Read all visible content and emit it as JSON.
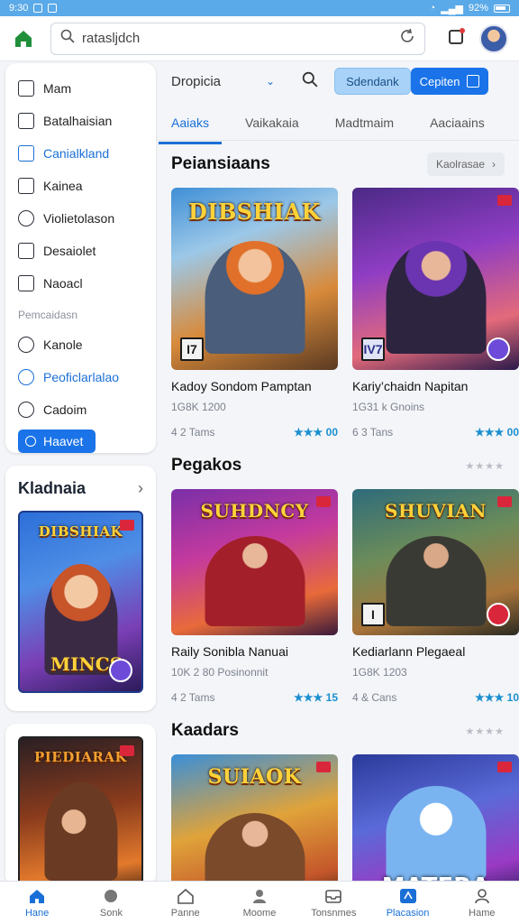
{
  "status": {
    "time": "9:30",
    "battery": "92%"
  },
  "topbar": {
    "search_value": "ratasljdch"
  },
  "sidebar": {
    "items": [
      {
        "label": "Mam",
        "blue": false
      },
      {
        "label": "Batalhaisian",
        "blue": false
      },
      {
        "label": "Canialkland",
        "blue": true
      },
      {
        "label": "Kainea",
        "blue": false
      },
      {
        "label": "Violietolason",
        "blue": false
      },
      {
        "label": "Desaiolet",
        "blue": false
      },
      {
        "label": "Naoacl",
        "blue": false
      }
    ],
    "section_label": "Pemcaidasn",
    "items2": [
      {
        "label": "Kanole",
        "blue": false
      },
      {
        "label": "Peoficlarlalao",
        "blue": true
      },
      {
        "label": "Cadoim",
        "blue": false
      }
    ],
    "active_label": "Haavet"
  },
  "side_card": {
    "title": "Kladnaia",
    "art1_title": "DIBSHIAK",
    "art1_footer": "MINCS",
    "art2_title": "PIEDIARAK"
  },
  "main": {
    "dropdown": "Dropicia",
    "btn_light": "Sdendank",
    "btn_primary": "Cepiten",
    "tabs": [
      "Aaiaks",
      "Vaikakaia",
      "Madtmaim",
      "Aaciaains"
    ],
    "sections": [
      {
        "title": "Peiansiaans",
        "more": "Kaolrasae",
        "cards": [
          {
            "art_title": "DIBSHIAK",
            "tag": "I7",
            "name": "Kadoy Sondom Pamptan",
            "meta": "1G8K 1200",
            "players": "4 2 Tams",
            "rating": "★★★ 00"
          },
          {
            "art_title": "",
            "tag": "IV7",
            "name": "Kariy’chaidn Napitan",
            "meta": "1G31 k Gnoins",
            "players": "6 3 Tans",
            "rating": "★★★ 00"
          }
        ]
      },
      {
        "title": "Pegakos",
        "more_stars": "★★★★",
        "cards": [
          {
            "art_title": "SUHDNCY",
            "tag": "",
            "name": "Raily Sonibla Nanuai",
            "meta": "10K 2 80 Posinonnit",
            "players": "4 2 Tams",
            "rating": "★★★ 15"
          },
          {
            "art_title": "SHUVIAN",
            "tag": "I",
            "name": "Kediarlann Plegaeal",
            "meta": "1G8K 1203",
            "players": "4 & Cans",
            "rating": "★★★ 10"
          }
        ]
      },
      {
        "title": "Kaadars",
        "more_stars": "★★★★",
        "cards": [
          {
            "art_title": "SUIAOK",
            "tag": "",
            "name": "",
            "meta": "",
            "players": "",
            "rating": ""
          },
          {
            "art_title": "MATERA",
            "tag": "",
            "name": "",
            "meta": "",
            "players": "",
            "rating": ""
          }
        ]
      }
    ]
  },
  "bottom_nav": [
    {
      "label": "Hane",
      "icon": "home-icon",
      "active": true
    },
    {
      "label": "Sonk",
      "icon": "gamepad-icon",
      "active": false
    },
    {
      "label": "Panne",
      "icon": "house-outline-icon",
      "active": false
    },
    {
      "label": "Moome",
      "icon": "people-icon",
      "active": false
    },
    {
      "label": "Tonsnmes",
      "icon": "inbox-icon",
      "active": false
    },
    {
      "label": "Placasion",
      "icon": "store-icon",
      "active": true
    },
    {
      "label": "Hame",
      "icon": "user-icon",
      "active": false
    }
  ],
  "colors": {
    "accent": "#1a73e8",
    "statusbar": "#5aa9e8"
  }
}
